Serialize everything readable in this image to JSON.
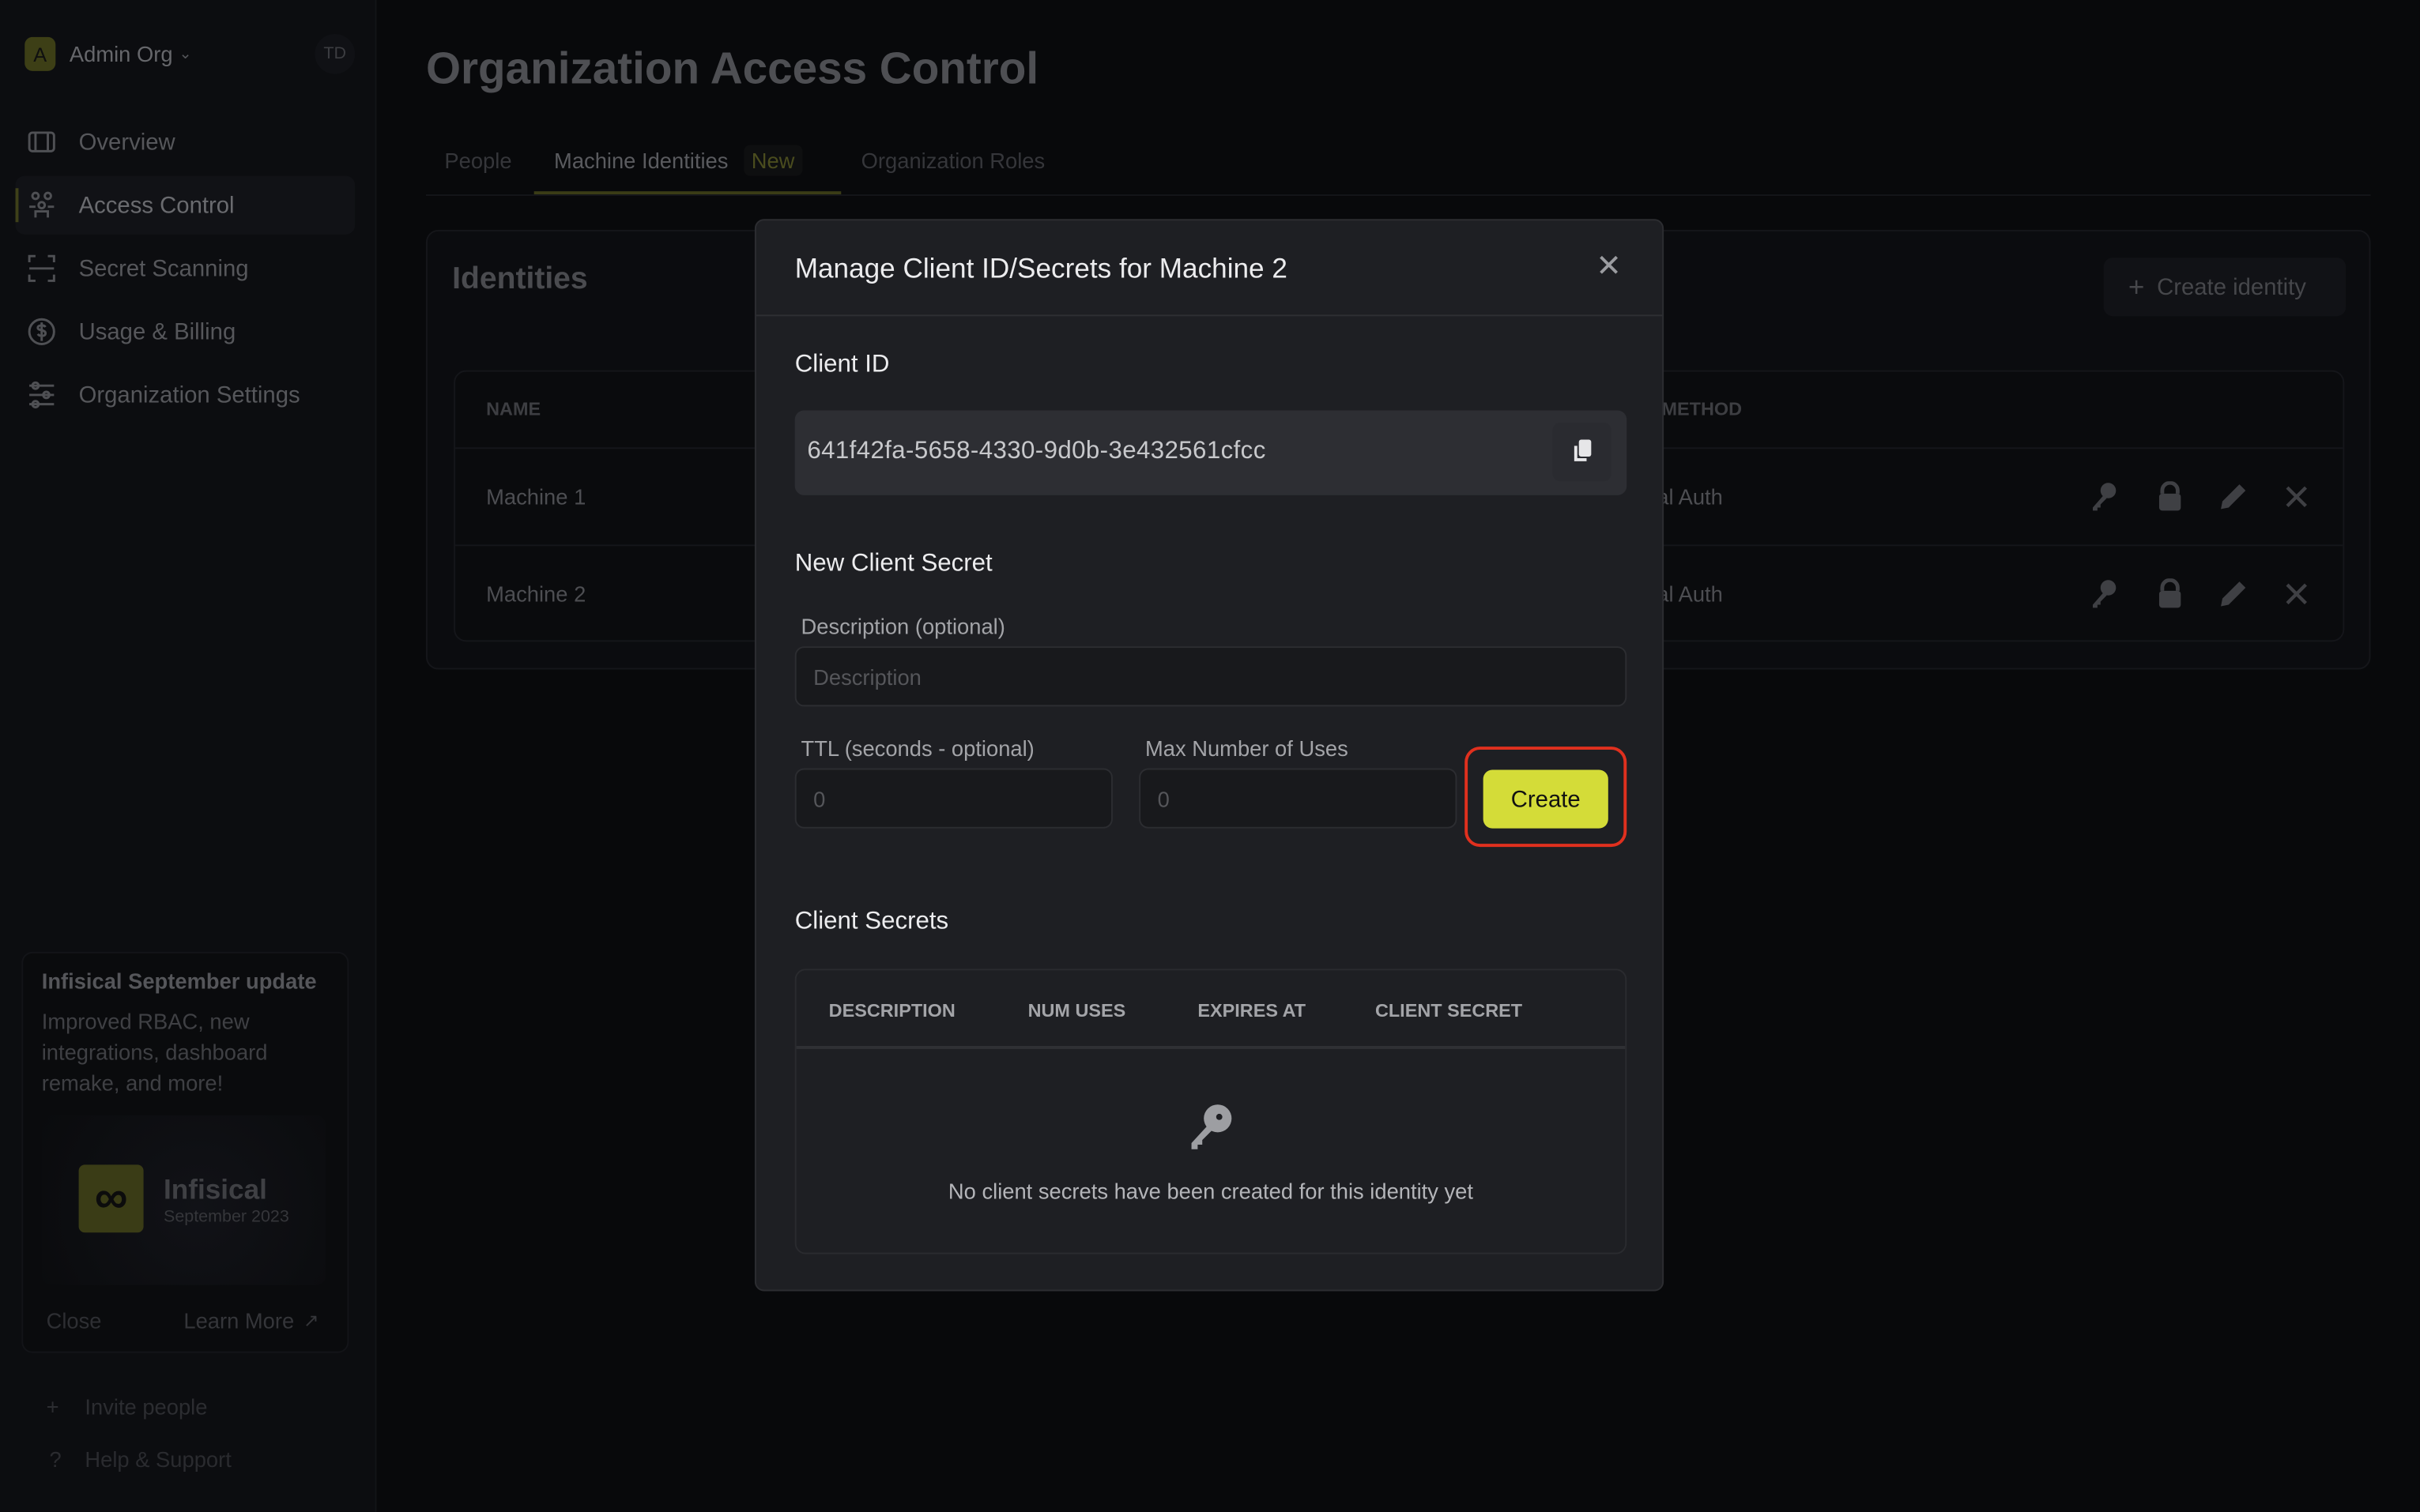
{
  "sidebar": {
    "org_initial": "A",
    "org_name": "Admin Org",
    "user_initials": "TD",
    "items": [
      {
        "label": "Overview",
        "icon": "overview-icon"
      },
      {
        "label": "Access Control",
        "icon": "users-icon",
        "active": true
      },
      {
        "label": "Secret Scanning",
        "icon": "scan-icon"
      },
      {
        "label": "Usage & Billing",
        "icon": "dollar-icon"
      },
      {
        "label": "Organization Settings",
        "icon": "sliders-icon"
      }
    ],
    "update_card": {
      "title": "Infisical September update",
      "body": "Improved RBAC, new integrations, dashboard remake, and more!",
      "image_title": "Infisical",
      "image_subtitle": "September 2023",
      "close_label": "Close",
      "learn_more_label": "Learn More"
    },
    "invite_label": "Invite people",
    "help_label": "Help & Support"
  },
  "main": {
    "title": "Organization Access Control",
    "tabs": [
      {
        "label": "People"
      },
      {
        "label": "Machine Identities",
        "badge": "New",
        "active": true
      },
      {
        "label": "Organization Roles"
      }
    ],
    "identities": {
      "heading": "Identities",
      "create_label": "Create identity",
      "columns": [
        "NAME",
        "AUTH METHOD"
      ],
      "rows": [
        {
          "name": "Machine 1",
          "auth": "Universal Auth"
        },
        {
          "name": "Machine 2",
          "auth": "Universal Auth"
        }
      ]
    }
  },
  "modal": {
    "title": "Manage Client ID/Secrets for Machine 2",
    "client_id_label": "Client ID",
    "client_id": "641f42fa-5658-4330-9d0b-3e432561cfcc",
    "new_secret_heading": "New Client Secret",
    "description_label": "Description (optional)",
    "description_placeholder": "Description",
    "ttl_label": "TTL (seconds - optional)",
    "ttl_placeholder": "0",
    "max_uses_label": "Max Number of Uses",
    "max_uses_placeholder": "0",
    "create_label": "Create",
    "secrets_heading": "Client Secrets",
    "secrets_columns": [
      "DESCRIPTION",
      "NUM USES",
      "EXPIRES AT",
      "CLIENT SECRET"
    ],
    "empty_message": "No client secrets have been created for this identity yet"
  },
  "colors": {
    "accent": "#d4dc38",
    "highlight": "#e0301e",
    "modal_bg": "#1e1f23"
  }
}
